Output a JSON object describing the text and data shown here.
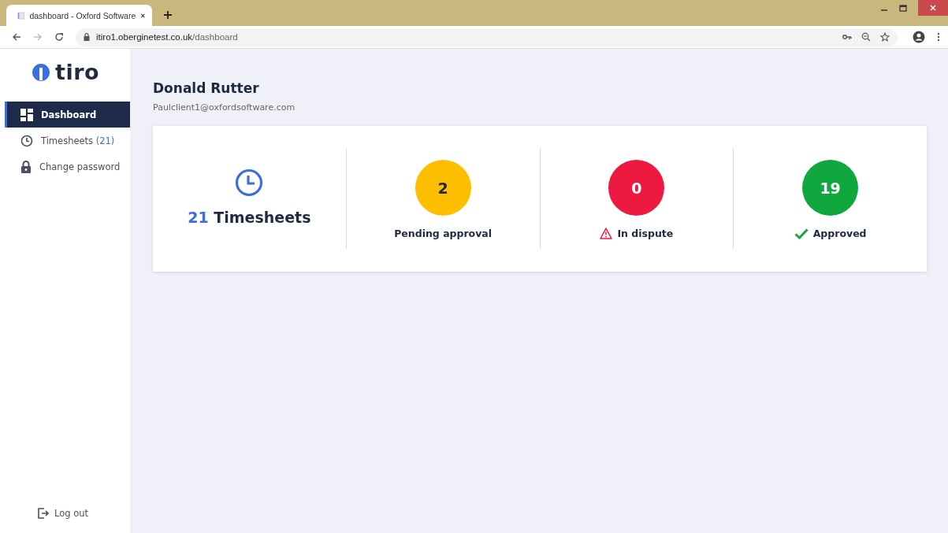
{
  "browser": {
    "tab_title": "dashboard - Oxford Software",
    "url_host": "itiro1.oberginetest.co.uk",
    "url_path": "/dashboard"
  },
  "logo": {
    "text": "tiro"
  },
  "sidebar": {
    "items": [
      {
        "label": "Dashboard",
        "kind": "dashboard",
        "selected": true
      },
      {
        "label": "Timesheets",
        "count": "(21)",
        "kind": "timesheets",
        "selected": false
      },
      {
        "label": "Change password",
        "kind": "password",
        "selected": false
      }
    ],
    "logout": "Log out"
  },
  "user": {
    "name": "Donald Rutter",
    "email": "Paulclient1@oxfordsoftware.com"
  },
  "stats": [
    {
      "kind": "total",
      "count": "21",
      "label": "Timesheets"
    },
    {
      "kind": "pending",
      "value": "2",
      "label": "Pending approval",
      "color": "#ffbe00"
    },
    {
      "kind": "dispute",
      "value": "0",
      "label": "In dispute",
      "color": "#ee1940"
    },
    {
      "kind": "approved",
      "value": "19",
      "label": "Approved",
      "color": "#10a83e"
    }
  ]
}
